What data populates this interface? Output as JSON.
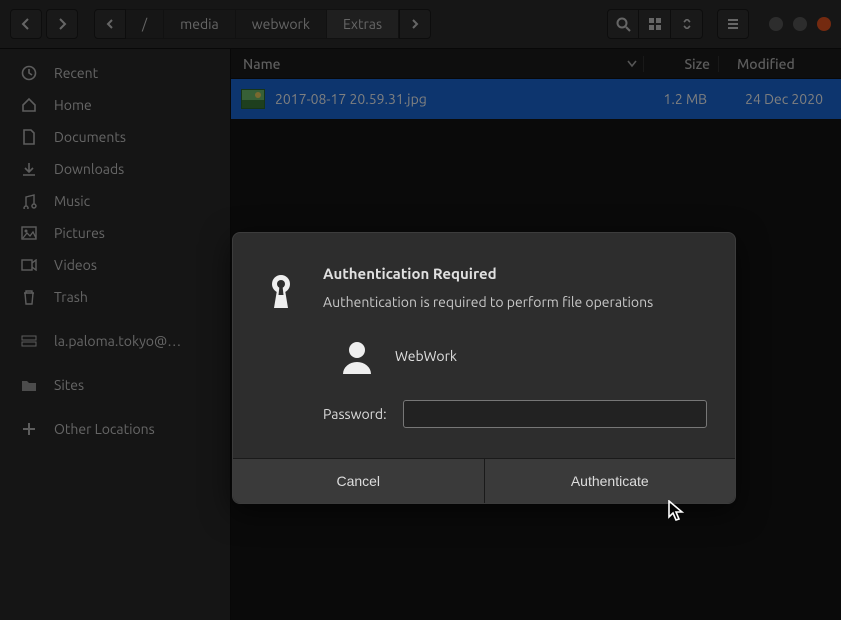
{
  "toolbar": {
    "path": [
      "/",
      "media",
      "webwork",
      "Extras"
    ],
    "active_path_index": 3
  },
  "sidebar": {
    "items": [
      {
        "icon": "clock",
        "label": "Recent"
      },
      {
        "icon": "home",
        "label": "Home"
      },
      {
        "icon": "doc",
        "label": "Documents"
      },
      {
        "icon": "download",
        "label": "Downloads"
      },
      {
        "icon": "music",
        "label": "Music"
      },
      {
        "icon": "picture",
        "label": "Pictures"
      },
      {
        "icon": "video",
        "label": "Videos"
      },
      {
        "icon": "trash",
        "label": "Trash"
      }
    ],
    "network_label": "la.paloma.tokyo@…",
    "sites_label": "Sites",
    "other_label": "Other Locations"
  },
  "columns": {
    "name": "Name",
    "size": "Size",
    "modified": "Modified"
  },
  "files": [
    {
      "name": "2017-08-17 20.59.31.jpg",
      "size": "1.2 MB",
      "modified": "24 Dec 2020"
    }
  ],
  "dialog": {
    "title": "Authentication Required",
    "message": "Authentication is required to perform file operations",
    "user": "WebWork",
    "password_label": "Password:",
    "cancel": "Cancel",
    "authenticate": "Authenticate",
    "password_value": ""
  }
}
